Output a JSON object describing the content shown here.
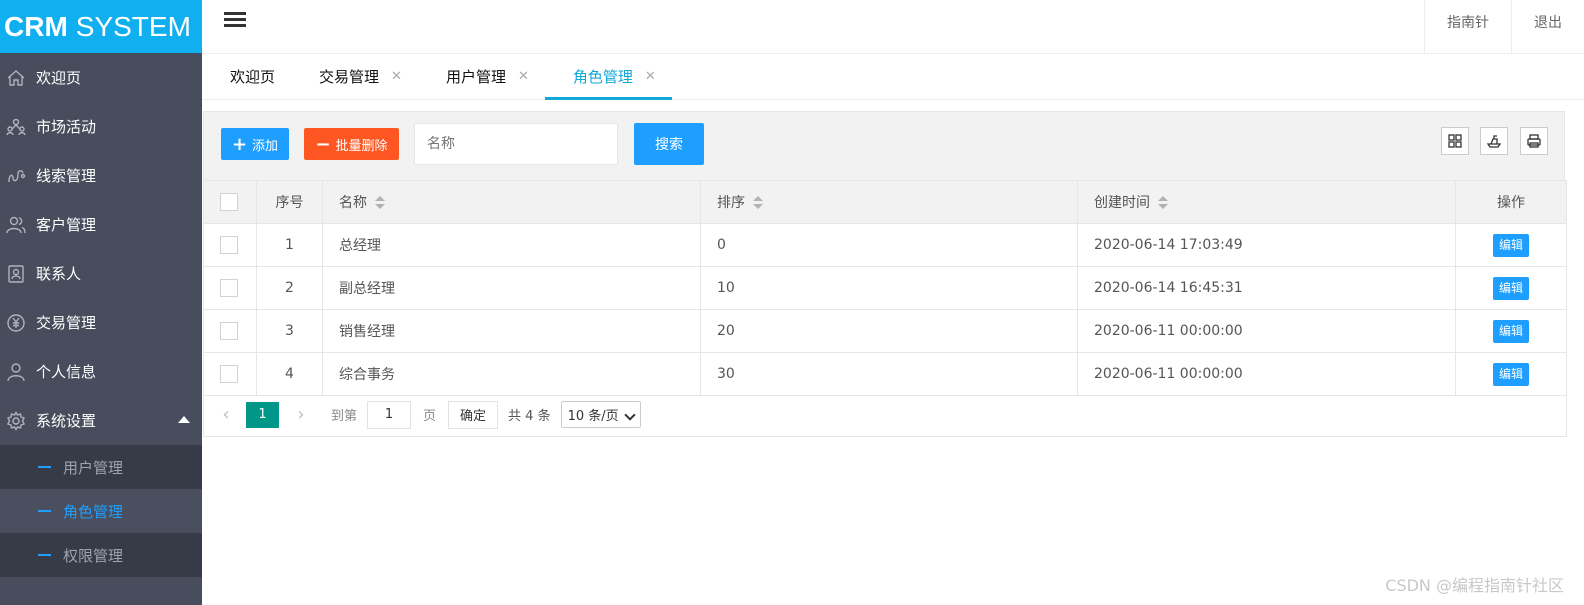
{
  "app": {
    "logo_bold": "CRM",
    "logo_light": "SYSTEM"
  },
  "sidebar": {
    "items": [
      {
        "label": "欢迎页",
        "icon": "home-icon"
      },
      {
        "label": "市场活动",
        "icon": "people-network-icon"
      },
      {
        "label": "线索管理",
        "icon": "clue-icon"
      },
      {
        "label": "客户管理",
        "icon": "users-icon"
      },
      {
        "label": "联系人",
        "icon": "contact-card-icon"
      },
      {
        "label": "交易管理",
        "icon": "yuan-icon"
      },
      {
        "label": "个人信息",
        "icon": "user-icon"
      },
      {
        "label": "系统设置",
        "icon": "gear-icon",
        "expanded": true
      }
    ],
    "sub_items": [
      {
        "label": "用户管理",
        "active": false
      },
      {
        "label": "角色管理",
        "active": true
      },
      {
        "label": "权限管理",
        "active": false
      }
    ]
  },
  "header": {
    "links": [
      "指南针",
      "退出"
    ]
  },
  "tabs": [
    {
      "label": "欢迎页",
      "closable": false,
      "active": false
    },
    {
      "label": "交易管理",
      "closable": true,
      "active": false
    },
    {
      "label": "用户管理",
      "closable": true,
      "active": false
    },
    {
      "label": "角色管理",
      "closable": true,
      "active": true
    }
  ],
  "toolbar": {
    "add_label": "添加",
    "batch_delete_label": "批量删除",
    "search_placeholder": "名称",
    "search_label": "搜索"
  },
  "table": {
    "columns": [
      "序号",
      "名称",
      "排序",
      "创建时间",
      "操作"
    ],
    "rows": [
      {
        "no": "1",
        "name": "总经理",
        "sort": "0",
        "created": "2020-06-14 17:03:49",
        "action": "编辑"
      },
      {
        "no": "2",
        "name": "副总经理",
        "sort": "10",
        "created": "2020-06-14 16:45:31",
        "action": "编辑"
      },
      {
        "no": "3",
        "name": "销售经理",
        "sort": "20",
        "created": "2020-06-11 00:00:00",
        "action": "编辑"
      },
      {
        "no": "4",
        "name": "综合事务",
        "sort": "30",
        "created": "2020-06-11 00:00:00",
        "action": "编辑"
      }
    ]
  },
  "pagination": {
    "current": "1",
    "goto_label": "到第",
    "goto_value": "1",
    "page_unit": "页",
    "confirm_label": "确定",
    "total": "共 4 条",
    "page_size": "10 条/页"
  },
  "watermark": "CSDN @编程指南针社区",
  "colors": {
    "logo_bg": "#10aff0",
    "sidebar_bg": "#474d5c",
    "primary": "#1e9fff",
    "danger": "#ff5722",
    "pager_active": "#009688"
  }
}
